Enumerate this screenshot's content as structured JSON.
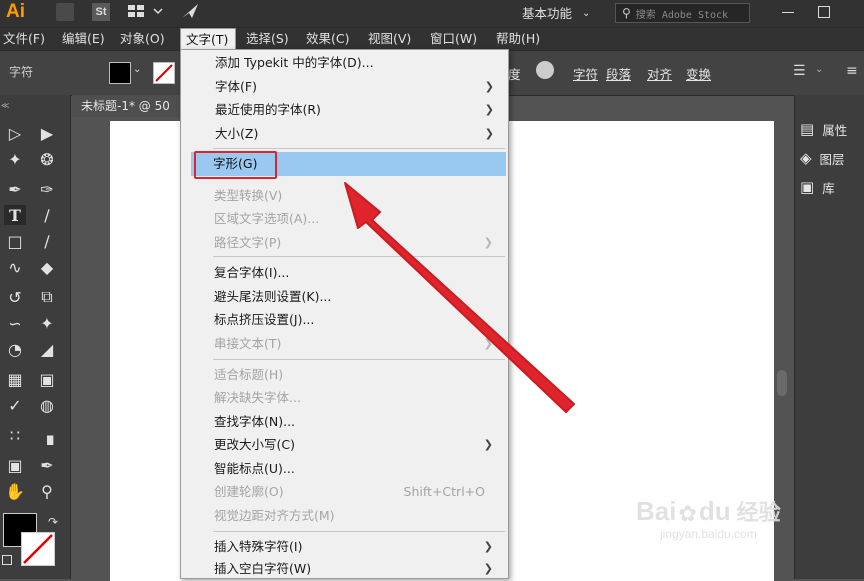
{
  "app": {
    "logo": "Ai",
    "workspace_label": "基本功能",
    "search_placeholder": "搜索 Adobe Stock",
    "st_badge": "St"
  },
  "menubar": {
    "items": [
      "文件(F)",
      "编辑(E)",
      "对象(O)",
      "文字(T)",
      "选择(S)",
      "效果(C)",
      "视图(V)",
      "窗口(W)",
      "帮助(H)"
    ],
    "active": "文字(T)"
  },
  "control_bar": {
    "label": "字符",
    "right_items": [
      "字符",
      "段落",
      "对齐",
      "变换"
    ]
  },
  "document": {
    "tab_title": "未标题-1* @ 50"
  },
  "type_menu": {
    "items": [
      {
        "label": "添加 Typekit 中的字体(D)...",
        "enabled": true
      },
      {
        "label": "字体(F)",
        "enabled": true,
        "submenu": true
      },
      {
        "label": "最近使用的字体(R)",
        "enabled": true,
        "submenu": true
      },
      {
        "label": "大小(Z)",
        "enabled": true,
        "submenu": true
      },
      {
        "label": "字形(G)",
        "enabled": true,
        "highlighted": true
      },
      {
        "label": "类型转换(V)",
        "enabled": false
      },
      {
        "label": "区域文字选项(A)...",
        "enabled": false
      },
      {
        "label": "路径文字(P)",
        "enabled": false,
        "submenu": true
      },
      {
        "label": "复合字体(I)...",
        "enabled": true
      },
      {
        "label": "避头尾法则设置(K)...",
        "enabled": true
      },
      {
        "label": "标点挤压设置(J)...",
        "enabled": true
      },
      {
        "label": "串接文本(T)",
        "enabled": false,
        "submenu": true
      },
      {
        "label": "适合标题(H)",
        "enabled": false
      },
      {
        "label": "解决缺失字体...",
        "enabled": false
      },
      {
        "label": "查找字体(N)...",
        "enabled": true
      },
      {
        "label": "更改大小写(C)",
        "enabled": true,
        "submenu": true
      },
      {
        "label": "智能标点(U)...",
        "enabled": true
      },
      {
        "label": "创建轮廓(O)",
        "enabled": false,
        "shortcut": "Shift+Ctrl+O"
      },
      {
        "label": "视觉边距对齐方式(M)",
        "enabled": false
      },
      {
        "label": "插入特殊字符(I)",
        "enabled": true,
        "submenu": true
      },
      {
        "label": "插入空白字符(W)",
        "enabled": true,
        "submenu": true
      }
    ]
  },
  "right_panels": {
    "items": [
      "属性",
      "图层",
      "库"
    ]
  },
  "watermark": {
    "brand": "Bai",
    "brand2": "du",
    "cn": "经验",
    "url": "jingyan.baidu.com"
  },
  "colors": {
    "highlight": "#99c9f1",
    "annotation_red": "#e0242b",
    "app_dark": "#323232",
    "ai_logo": "#ff9a00"
  },
  "icons": {
    "tools": [
      "selection-tool-icon",
      "direct-selection-tool-icon",
      "magic-wand-icon",
      "lasso-icon",
      "pen-tool-icon",
      "curvature-tool-icon",
      "type-tool-icon",
      "line-tool-icon",
      "rectangle-tool-icon",
      "paintbrush-icon",
      "shaper-icon",
      "eraser-icon",
      "rotate-icon",
      "scale-icon",
      "width-tool-icon",
      "puppet-warp-icon",
      "shape-builder-icon",
      "perspective-grid-icon",
      "mesh-icon",
      "gradient-icon",
      "eyedropper-icon",
      "blend-icon",
      "symbol-sprayer-icon",
      "column-graph-icon",
      "artboard-tool-icon",
      "slice-icon",
      "hand-icon",
      "zoom-icon"
    ]
  }
}
